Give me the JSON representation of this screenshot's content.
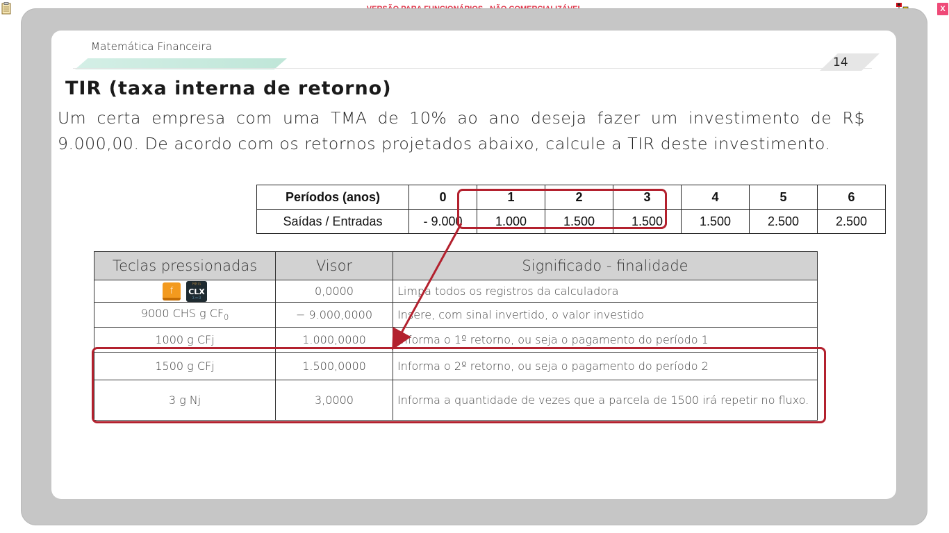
{
  "window": {
    "warning_banner": "VERSÃO PARA FUNCIONÁRIOS - NÃO COMERCIALIZÁVEL",
    "close_label": "X",
    "icons": [
      "clipboard-icon",
      "network-icon"
    ]
  },
  "slide": {
    "subject": "Matemática Financeira",
    "page_number": "14",
    "title": "TIR (taxa interna de retorno)",
    "paragraph": "Um certa empresa com uma TMA de 10% ao ano deseja fazer um investimento de R$ 9.000,00. De acordo com os retornos projetados abaixo, calcule a TIR deste investimento."
  },
  "cashflow_table": {
    "row_labels": [
      "Períodos (anos)",
      "Saídas / Entradas"
    ],
    "periods": [
      "0",
      "1",
      "2",
      "3",
      "4",
      "5",
      "6"
    ],
    "values": [
      "- 9.000",
      "1.000",
      "1.500",
      "1.500",
      "1.500",
      "2.500",
      "2.500"
    ]
  },
  "keys_table": {
    "headers": [
      "Teclas pressionadas",
      "Visor",
      "Significado - finalidade"
    ],
    "calc_keys": {
      "f": "f",
      "clx_top": "REG",
      "clx": "CLX",
      "clx_bottom": "Σ=0"
    },
    "rows": [
      {
        "keys": "",
        "display": "0,0000",
        "meaning": "Limpa todos os registros da calculadora"
      },
      {
        "keys": "9000 CHS g CF",
        "keys_sub": "0",
        "display": "− 9.000,0000",
        "meaning": "Insere, com sinal invertido, o valor investido"
      },
      {
        "keys": "1000 g  CFj",
        "display": "1.000,0000",
        "meaning": "Informa o 1º retorno, ou seja o pagamento do período 1"
      },
      {
        "keys": "1500 g  CFj",
        "display": "1.500,0000",
        "meaning": "Informa o 2º retorno, ou seja o pagamento do período 2"
      },
      {
        "keys": "3 g  Nj",
        "display": "3,0000",
        "meaning": "Informa a quantidade de vezes que a parcela de 1500 irá repetir no fluxo."
      }
    ]
  },
  "accent_color": "#b3212e"
}
